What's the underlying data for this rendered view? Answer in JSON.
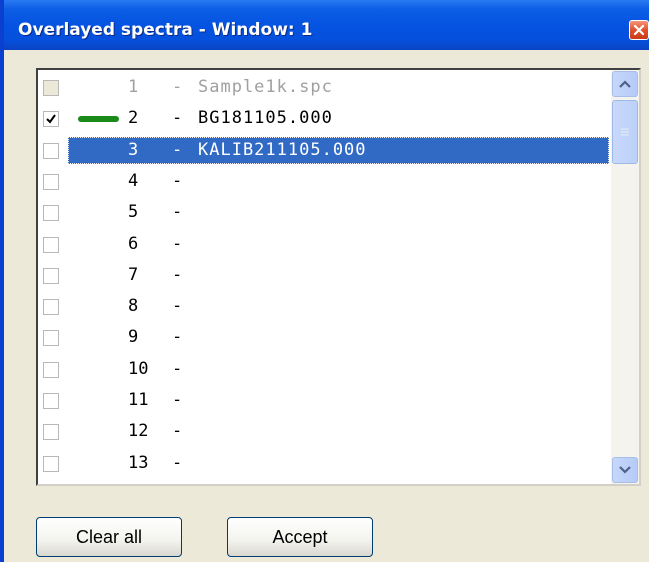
{
  "window": {
    "title": "Overlayed spectra - Window: 1"
  },
  "list": {
    "rows": [
      {
        "num": "1",
        "dash": "-",
        "name": "Sample1k.spc",
        "checked": false,
        "greyed": true,
        "selected": false,
        "swatch": false
      },
      {
        "num": "2",
        "dash": "-",
        "name": "BG181105.000",
        "checked": true,
        "greyed": false,
        "selected": false,
        "swatch": true
      },
      {
        "num": "3",
        "dash": "-",
        "name": "KALIB211105.000",
        "checked": false,
        "greyed": false,
        "selected": true,
        "swatch": false
      },
      {
        "num": "4",
        "dash": "-",
        "name": "",
        "checked": false
      },
      {
        "num": "5",
        "dash": "-",
        "name": "",
        "checked": false
      },
      {
        "num": "6",
        "dash": "-",
        "name": "",
        "checked": false
      },
      {
        "num": "7",
        "dash": "-",
        "name": "",
        "checked": false
      },
      {
        "num": "8",
        "dash": "-",
        "name": "",
        "checked": false
      },
      {
        "num": "9",
        "dash": "-",
        "name": "",
        "checked": false
      },
      {
        "num": "10",
        "dash": "-",
        "name": "",
        "checked": false
      },
      {
        "num": "11",
        "dash": "-",
        "name": "",
        "checked": false
      },
      {
        "num": "12",
        "dash": "-",
        "name": "",
        "checked": false
      },
      {
        "num": "13",
        "dash": "-",
        "name": "",
        "checked": false
      }
    ],
    "swatch_color": "#1a8a1a"
  },
  "buttons": {
    "clear_all": "Clear all",
    "accept": "Accept"
  },
  "colors": {
    "titlebar": "#0553e1",
    "selection": "#316ac5",
    "dialog_bg": "#ece9d8"
  },
  "icons": {
    "close": "close-icon",
    "scroll_up": "chevron-up-icon",
    "scroll_down": "chevron-down-icon",
    "check": "checkmark-icon"
  }
}
